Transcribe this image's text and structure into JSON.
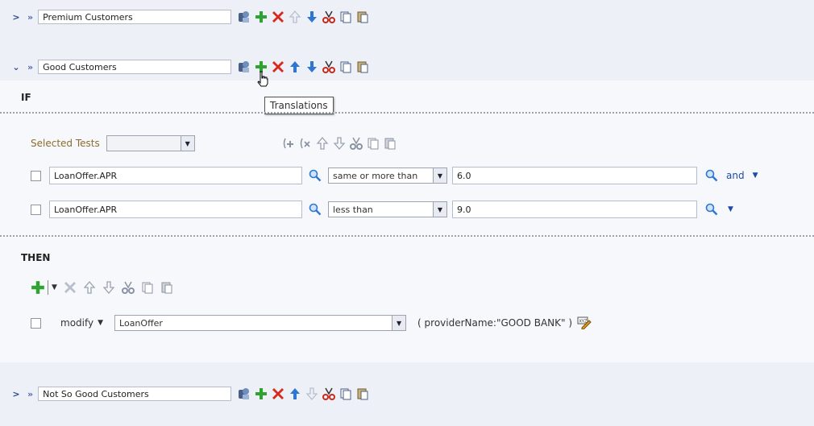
{
  "rules": [
    {
      "name": "Premium Customers",
      "expanded": false
    },
    {
      "name": "Good Customers",
      "expanded": true
    },
    {
      "name": "Not So Good Customers",
      "expanded": false
    }
  ],
  "tooltip": "Translations",
  "if_section": {
    "keyword": "IF",
    "selected_tests_label": "Selected Tests",
    "tests": [
      {
        "attribute": "LoanOffer.APR",
        "operator": "same or more than",
        "value": "6.0",
        "connector": "and"
      },
      {
        "attribute": "LoanOffer.APR",
        "operator": "less than",
        "value": "9.0",
        "connector": ""
      }
    ]
  },
  "then_section": {
    "keyword": "THEN",
    "action": "modify",
    "target": "LoanOffer",
    "expression": "( providerName:\"GOOD BANK\" )"
  },
  "icons": {
    "rule_toolbar": [
      "translations-icon",
      "add-icon",
      "delete-icon",
      "move-up-icon",
      "move-down-icon",
      "cut-icon",
      "copy-icon",
      "paste-icon"
    ]
  },
  "colors": {
    "accent": "#1f4aa8",
    "add_green": "#2fa32f",
    "delete_red": "#d62a1e",
    "arrow_blue": "#2e76d3"
  }
}
